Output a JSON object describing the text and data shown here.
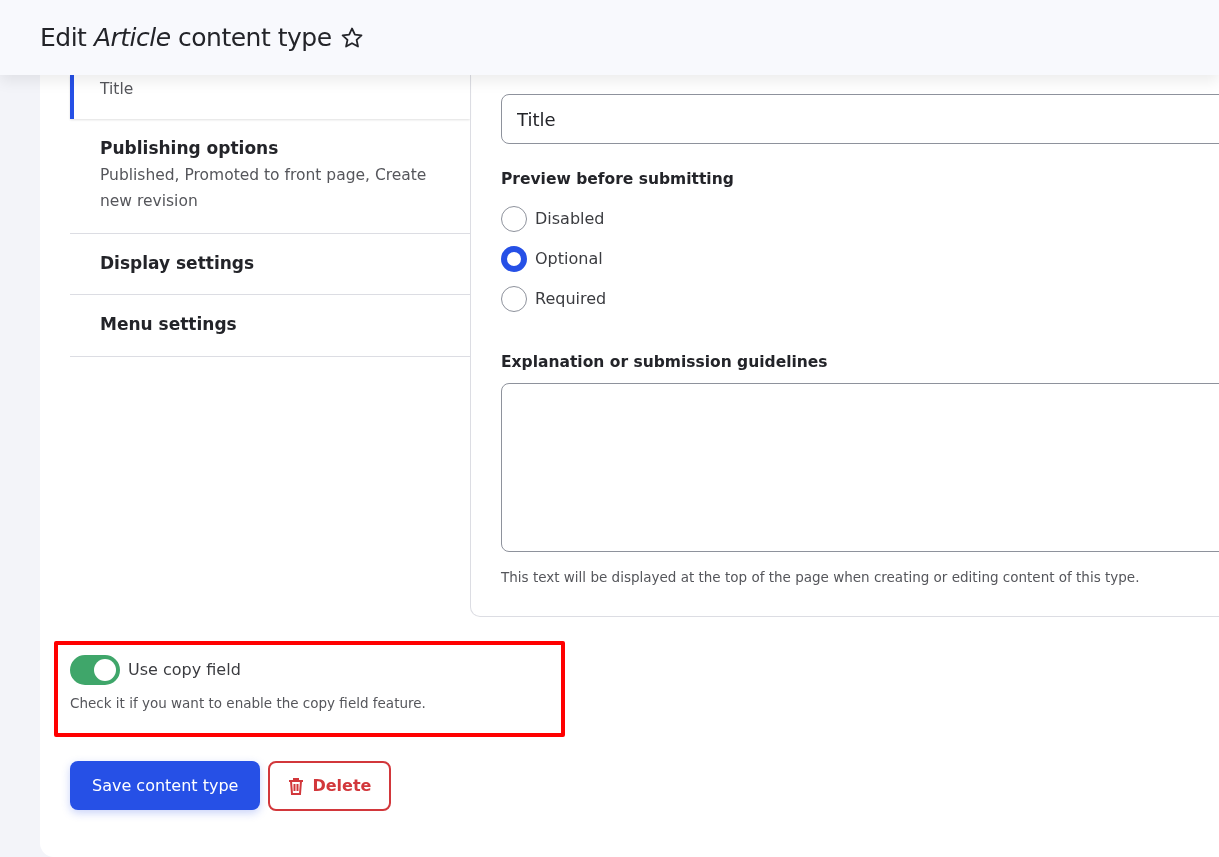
{
  "header": {
    "title": "Edit *Article* content type"
  },
  "vertical_tabs": [
    {
      "summary": "Title",
      "selected": true
    },
    {
      "title": "Publishing options",
      "summary": "Published, Promoted to front page, Create new revision",
      "selected": false
    },
    {
      "title": "Display settings",
      "selected": false
    },
    {
      "title": "Menu settings",
      "selected": false
    }
  ],
  "panel": {
    "title_field": {
      "value": "Title"
    },
    "preview": {
      "label": "Preview before submitting",
      "options": [
        {
          "label": "Disabled",
          "selected": false
        },
        {
          "label": "Optional",
          "selected": true
        },
        {
          "label": "Required",
          "selected": false
        }
      ]
    },
    "explanation": {
      "label": "Explanation or submission guidelines",
      "description": "This text will be displayed at the top of the page when creating or editing content of this type."
    }
  },
  "copy_field": {
    "label": "Use copy field",
    "on": true,
    "description": "Check it if you want to enable the copy field feature."
  },
  "buttons": [
    {
      "label": "Save content type",
      "kind": "primary"
    },
    {
      "label": "Delete",
      "kind": "danger"
    }
  ]
}
